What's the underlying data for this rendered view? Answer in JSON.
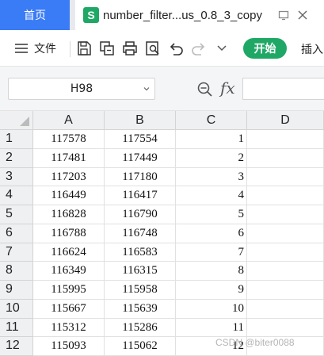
{
  "tabs": {
    "home_label": "首页",
    "file_icon_letter": "S",
    "doc_title": "number_filter...us_0.8_3_copy"
  },
  "toolbar": {
    "menu_label": "文件",
    "start_label": "开始",
    "insert_label": "插入"
  },
  "formula_bar": {
    "cell_ref": "H98",
    "fx_label": "fx"
  },
  "sheet": {
    "columns": [
      "A",
      "B",
      "C",
      "D"
    ],
    "rows": [
      {
        "num": "1",
        "a": "117578",
        "b": "117554",
        "c": "1"
      },
      {
        "num": "2",
        "a": "117481",
        "b": "117449",
        "c": "2"
      },
      {
        "num": "3",
        "a": "117203",
        "b": "117180",
        "c": "3"
      },
      {
        "num": "4",
        "a": "116449",
        "b": "116417",
        "c": "4"
      },
      {
        "num": "5",
        "a": "116828",
        "b": "116790",
        "c": "5"
      },
      {
        "num": "6",
        "a": "116788",
        "b": "116748",
        "c": "6"
      },
      {
        "num": "7",
        "a": "116624",
        "b": "116583",
        "c": "7"
      },
      {
        "num": "8",
        "a": "116349",
        "b": "116315",
        "c": "8"
      },
      {
        "num": "9",
        "a": "115995",
        "b": "115958",
        "c": "9"
      },
      {
        "num": "10",
        "a": "115667",
        "b": "115639",
        "c": "10"
      },
      {
        "num": "11",
        "a": "115312",
        "b": "115286",
        "c": "11"
      },
      {
        "num": "12",
        "a": "115093",
        "b": "115062",
        "c": "12"
      }
    ]
  },
  "watermark": "CSDN @biter0088",
  "colors": {
    "accent_blue": "#3a7bf6",
    "brand_green": "#1fa865"
  }
}
